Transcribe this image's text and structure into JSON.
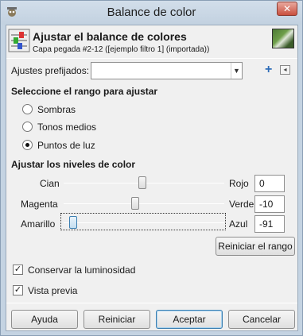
{
  "window": {
    "title": "Balance de color",
    "close_label": "✕"
  },
  "header": {
    "title": "Ajustar el balance de colores",
    "subtitle": "Capa pegada #2-12 ([ejemplo filtro 1] (importada))"
  },
  "presets": {
    "label": "Ajustes prefijados:",
    "value": "",
    "add_icon": "+",
    "menu_icon": "◂"
  },
  "range": {
    "heading": "Seleccione el rango para ajustar",
    "options": [
      {
        "label": "Sombras",
        "selected": false
      },
      {
        "label": "Tonos medios",
        "selected": false
      },
      {
        "label": "Puntos de luz",
        "selected": true
      }
    ]
  },
  "levels": {
    "heading": "Ajustar los niveles de color",
    "rows": [
      {
        "left": "Cian",
        "right": "Rojo",
        "value": "0"
      },
      {
        "left": "Magenta",
        "right": "Verde",
        "value": "-10"
      },
      {
        "left": "Amarillo",
        "right": "Azul",
        "value": "-91"
      }
    ],
    "reset_range": "Reiniciar el rango"
  },
  "options": {
    "preserve": {
      "label": "Conservar la luminosidad",
      "checked": true
    },
    "preview": {
      "label": "Vista previa",
      "checked": true
    }
  },
  "buttons": {
    "help": "Ayuda",
    "reset": "Reiniciar",
    "ok": "Aceptar",
    "cancel": "Cancelar"
  },
  "colors": {
    "titlebar": "#c4d3e2",
    "client": "#f0f0f0",
    "accent": "#3c7fb1",
    "close": "#c9503f"
  }
}
